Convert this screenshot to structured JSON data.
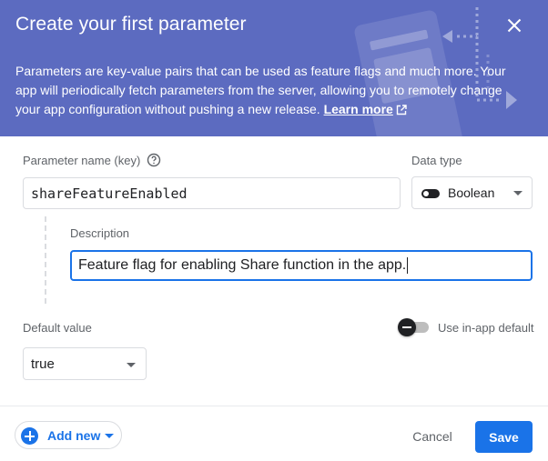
{
  "dialog": {
    "title": "Create your first parameter",
    "intro_text": "Parameters are key-value pairs that can be used as feature flags and much more. Your app will periodically fetch parameters from the server, allowing you to remotely change your app configuration without pushing a new release.",
    "learn_more": "Learn more"
  },
  "form": {
    "param_name_label": "Parameter name (key)",
    "param_name_value": "shareFeatureEnabled",
    "data_type_label": "Data type",
    "data_type_value": "Boolean",
    "description_label": "Description",
    "description_value": "Feature flag for enabling Share function in the app.",
    "default_value_label": "Default value",
    "default_value": "true",
    "use_inapp_default_label": "Use in-app default"
  },
  "footer": {
    "add_new": "Add new",
    "cancel": "Cancel",
    "save": "Save"
  },
  "colors": {
    "header_bg": "#5c6bc0",
    "primary": "#1a73e8"
  },
  "icons": [
    "close-icon",
    "help-icon",
    "external-link-icon",
    "toggle-icon",
    "chevron-down-icon",
    "add-circle-icon"
  ]
}
